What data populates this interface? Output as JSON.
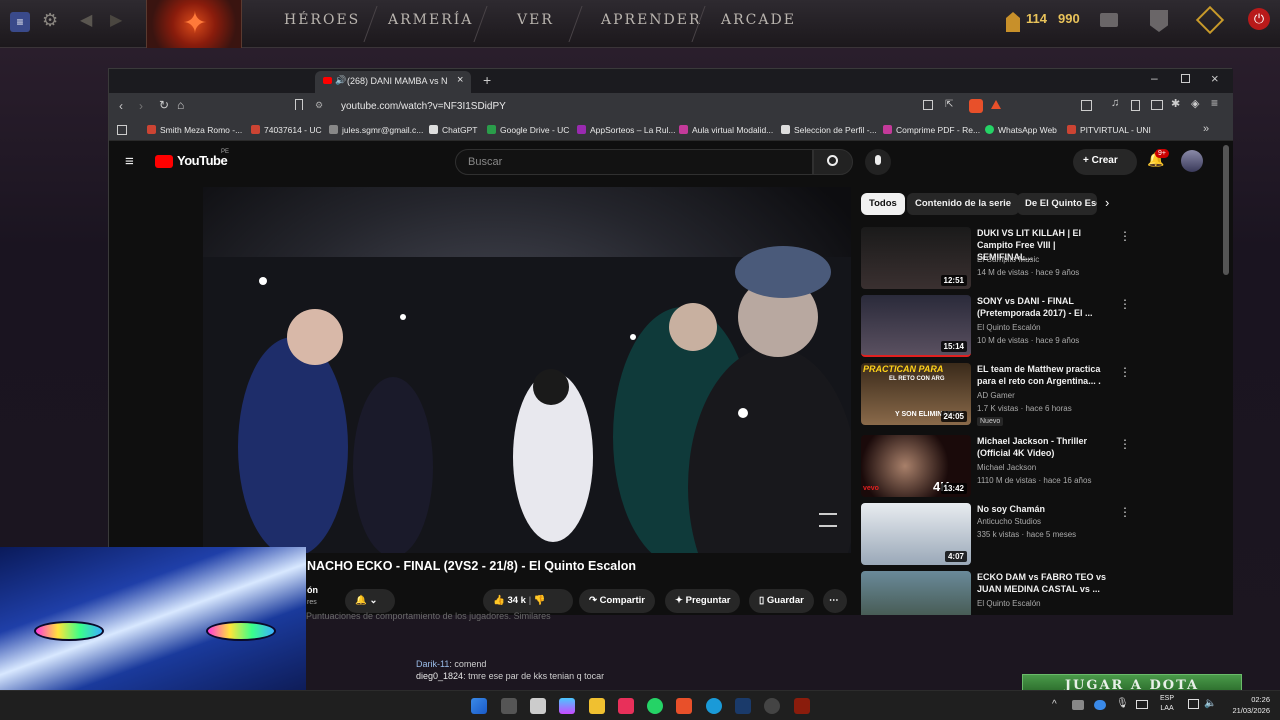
{
  "dota": {
    "nav": [
      "HÉROES",
      "ARMERÍA",
      "VER",
      "APRENDER",
      "ARCADE"
    ],
    "currency_a": "114",
    "currency_b": "990"
  },
  "browser": {
    "tab_title": "(268) DANI MAMBA vs NACH",
    "url": "youtube.com/watch?v=NF3I1SDidPY",
    "bookmarks": [
      "Smith Meza Romo -...",
      "74037614 - UC",
      "jules.sgmr@gmail.c...",
      "ChatGPT",
      "Google Drive - UC",
      "AppSorteos – La Rul...",
      "Aula virtual Modalid...",
      "Seleccion de Perfil -...",
      "Comprime PDF - Re...",
      "WhatsApp Web",
      "PITVIRTUAL - UNI"
    ]
  },
  "youtube": {
    "logo": "YouTube",
    "region": "PE",
    "search_placeholder": "Buscar",
    "create_label": "Crear",
    "notif_count": "9+",
    "chips": [
      "Todos",
      "Contenido de la serie",
      "De El Quinto Esc"
    ],
    "video_title": "NACHO ECKO - FINAL (2VS2 - 21/8) - El Quinto Escalon",
    "channel_partial": "ón",
    "subs_partial": "res",
    "likes": "34 k",
    "share_label": "Compartir",
    "ask_label": "Preguntar",
    "save_label": "Guardar",
    "behind_text": "Puntuaciones de comportamiento de los jugadores. Similares",
    "recs": [
      {
        "title": "DUKI VS LIT KILLAH | El Campito Free VIII | SEMIFINAL...",
        "channel": "El Campito Music",
        "meta": "14 M de vistas · hace 9 años",
        "duration": "12:51"
      },
      {
        "title": "SONY vs DANI - FINAL (Pretemporada 2017) - El ...",
        "channel": "El Quinto Escalón",
        "meta": "10 M de vistas · hace 9 años",
        "duration": "15:14"
      },
      {
        "title": "EL team de Matthew practica para el reto con Argentina... .",
        "channel": "AD Gamer",
        "meta": "1.7 K vistas · hace 6 horas",
        "badge": "Nuevo",
        "duration": "24:05",
        "thumb_text": "PRACTICAN PARA",
        "thumb_text2": "EL RETO CON ARG",
        "thumb_text3": "Y SON ELIMINADOS"
      },
      {
        "title": "Michael Jackson - Thriller (Official 4K Video)",
        "channel": "Michael Jackson",
        "meta": "1110 M de vistas · hace 16 años",
        "duration": "13:42",
        "thumb_text": "4K",
        "thumb_text2": "vevo"
      },
      {
        "title": "No soy Chamán",
        "channel": "Anticucho Studios",
        "meta": "335 k vistas · hace 5 meses",
        "duration": "4:07"
      },
      {
        "title": "ECKO DAM vs FABRO TEO vs JUAN MEDINA CASTAL vs ...",
        "channel": "El Quinto Escalón",
        "meta": "",
        "duration": ""
      }
    ]
  },
  "chat": [
    {
      "user": "Darik-11",
      "text": ": comend"
    },
    {
      "user": "dieg0_1824",
      "text": ": tmre ese par de kks tenian q tocar"
    }
  ],
  "play_button": "JUGAR A DOTA",
  "taskbar": {
    "lang_a": "ESP",
    "lang_b": "LAA",
    "time": "02:26",
    "date": "21/03/2026"
  }
}
